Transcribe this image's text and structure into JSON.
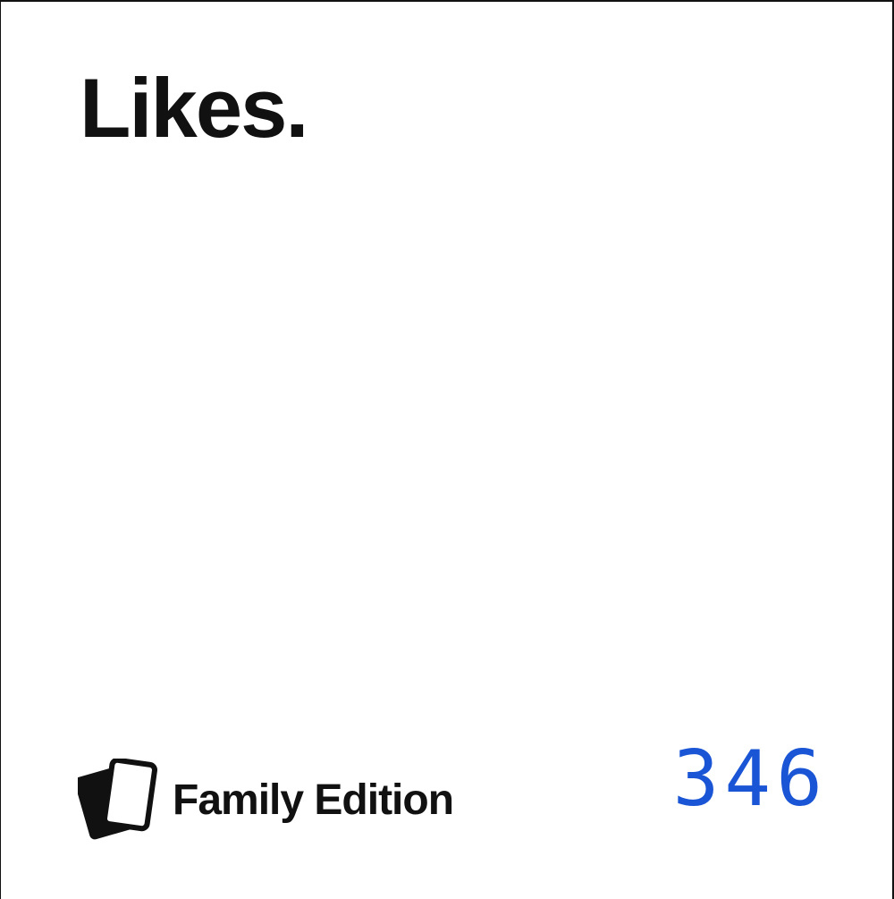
{
  "card": {
    "title": "Likes.",
    "brand": {
      "logo_icon": "stacked-cards-icon",
      "name": "Family Edition"
    },
    "number": "346",
    "colors": {
      "text": "#111111",
      "number": "#1a55d6",
      "background": "#ffffff"
    }
  }
}
